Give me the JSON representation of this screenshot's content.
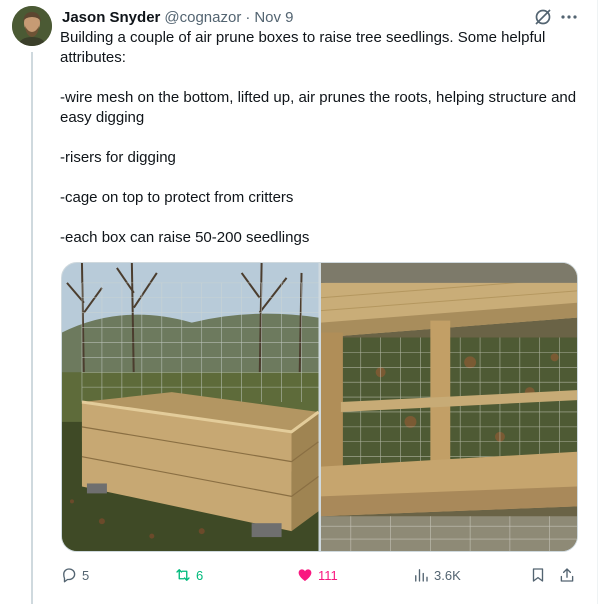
{
  "tweet": {
    "author_name": "Jason Snyder",
    "author_handle": "@cognazor",
    "separator": "·",
    "date": "Nov 9",
    "lines": [
      "Building a couple of air prune boxes to raise tree seedlings. Some helpful attributes:",
      "",
      "-wire mesh on the bottom, lifted up, air prunes the roots, helping structure and easy digging",
      "",
      "-risers for digging",
      "",
      "-cage on top to protect from critters",
      "",
      "-each box can raise 50-200 seedlings"
    ]
  },
  "actions": {
    "replies": "5",
    "retweets": "6",
    "likes": "111",
    "views": "3.6K"
  },
  "icons": {
    "avatar": "avatar",
    "grok": "grok-icon",
    "more": "more-icon",
    "reply": "reply-icon",
    "retweet": "retweet-icon",
    "like": "heart-icon",
    "views": "views-icon",
    "bookmark": "bookmark-icon",
    "share": "share-icon"
  },
  "colors": {
    "text": "#0f1419",
    "secondary": "#536471",
    "retweet": "#00ba7c",
    "like": "#f91880",
    "border": "#cfd9de"
  }
}
